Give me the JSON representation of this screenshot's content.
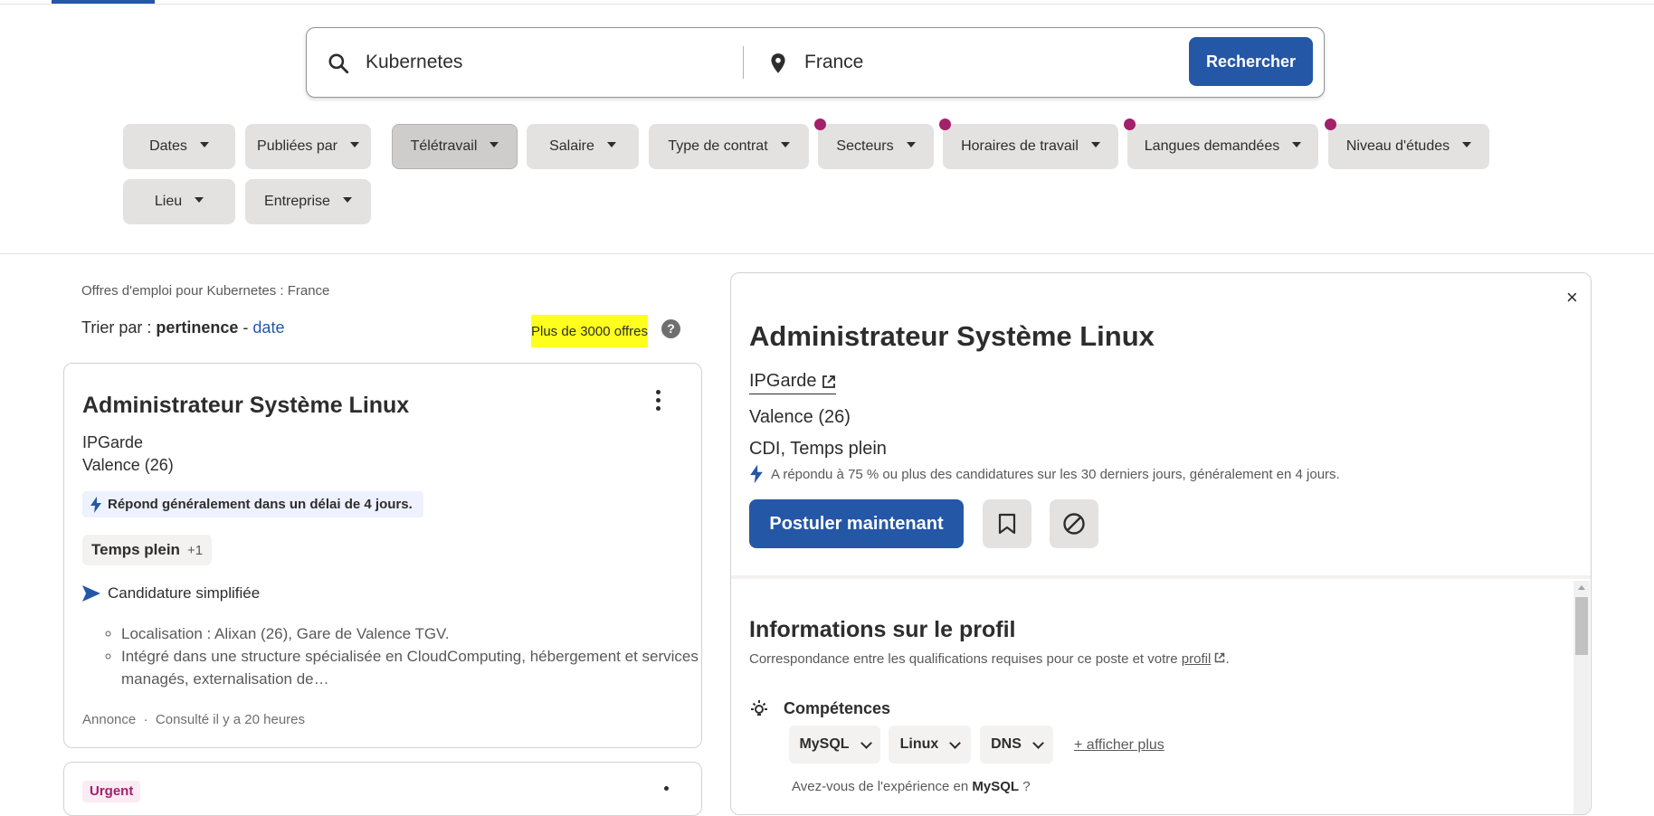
{
  "search": {
    "what_value": "Kubernetes",
    "where_value": "France",
    "button_label": "Rechercher"
  },
  "filters": [
    {
      "label": "Dates"
    },
    {
      "label": "Publiées par"
    },
    {
      "label": "Télétravail"
    },
    {
      "label": "Salaire"
    },
    {
      "label": "Type de contrat"
    },
    {
      "label": "Secteurs"
    },
    {
      "label": "Horaires de travail"
    },
    {
      "label": "Langues demandées"
    },
    {
      "label": "Niveau d'études"
    },
    {
      "label": "Lieu"
    },
    {
      "label": "Entreprise"
    }
  ],
  "results": {
    "header": "Offres d'emploi pour Kubernetes : France",
    "sort_prefix": "Trier par :",
    "sort_active": "pertinence",
    "sort_sep": "-",
    "sort_alt": "date",
    "count": "Plus de 3000 offres",
    "help": "?"
  },
  "job_card": {
    "title": "Administrateur Système Linux",
    "company": "IPGarde",
    "location": "Valence (26)",
    "response": "Répond généralement dans un délai de 4 jours.",
    "type": "Temps plein",
    "type_more": "+1",
    "simple_apply": "Candidature simplifiée",
    "snippets": [
      "Localisation : Alixan (26), Gare de Valence TGV.",
      "Intégré dans une structure spécialisée en CloudComputing, hébergement et services managés, externalisation de…"
    ],
    "meta_ad": "Annonce",
    "meta_dot": "·",
    "meta_viewed": "Consulté il y a 20 heures"
  },
  "job_card2": {
    "badge": "Urgent"
  },
  "detail": {
    "close": "×",
    "title": "Administrateur Système Linux",
    "company": "IPGarde",
    "location": "Valence (26)",
    "type": "CDI, Temps plein",
    "response": "A répondu à 75 % ou plus des candidatures sur les 30 derniers jours, généralement en 4 jours.",
    "apply_label": "Postuler maintenant",
    "profile_title": "Informations sur le profil",
    "profile_sub": "Correspondance entre les qualifications requises pour ce poste et votre",
    "profile_link": "profil",
    "profile_end": ".",
    "skills_head": "Compétences",
    "skills": [
      "MySQL",
      "Linux",
      "DNS"
    ],
    "show_more": "+ afficher plus",
    "experience_prefix": "Avez-vous de l'expérience en",
    "experience_skill": "MySQL",
    "experience_suffix": " ?"
  },
  "colors": {
    "brand": "#2557a7",
    "highlight": "#ffff1e",
    "filter_dot": "#a3206a"
  }
}
